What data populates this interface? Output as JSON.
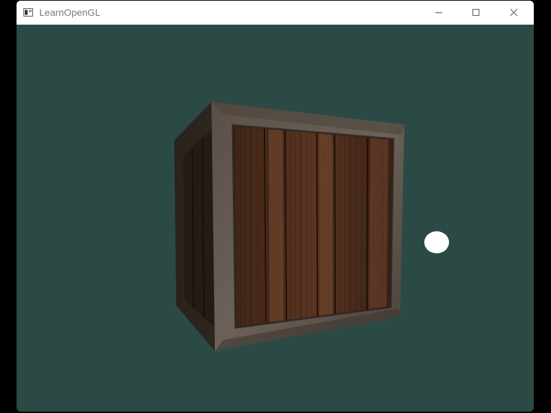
{
  "window": {
    "title": "LearnOpenGL"
  },
  "icons": {
    "app": "app-window-icon",
    "minimize": "minimize-icon",
    "maximize": "maximize-icon",
    "close": "close-icon"
  },
  "scene": {
    "objects": [
      "wooden-crate",
      "light-source"
    ]
  },
  "colors": {
    "clear_color": "#2b4a45",
    "titlebar": "#ffffff",
    "title_text": "#7a7a7a",
    "light_cube": "#ffffff"
  }
}
